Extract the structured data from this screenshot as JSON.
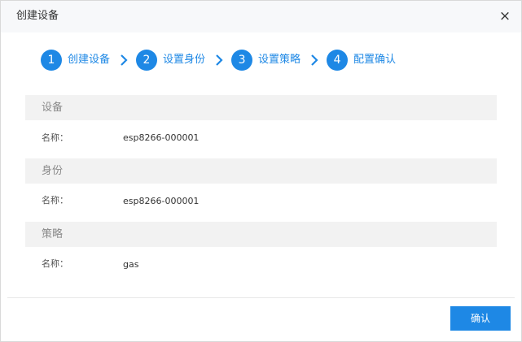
{
  "dialog": {
    "title": "创建设备",
    "close_glyph": "×"
  },
  "steps": [
    {
      "number": "1",
      "label": "创建设备"
    },
    {
      "number": "2",
      "label": "设置身份"
    },
    {
      "number": "3",
      "label": "设置策略"
    },
    {
      "number": "4",
      "label": "配置确认"
    }
  ],
  "sections": {
    "device": {
      "title": "设备",
      "field_label": "名称：",
      "field_value": "esp8266-000001"
    },
    "identity": {
      "title": "身份",
      "field_label": "名称：",
      "field_value": "esp8266-000001"
    },
    "policy": {
      "title": "策略",
      "field_label": "名称：",
      "field_value": "gas"
    }
  },
  "footer": {
    "confirm_label": "确认"
  },
  "colors": {
    "accent": "#1e88e5",
    "section_bg": "#f2f2f2",
    "header_bg": "#f7f8fa"
  },
  "icons": {
    "close": "close-icon",
    "step_separator": "chevron-right-icon"
  }
}
